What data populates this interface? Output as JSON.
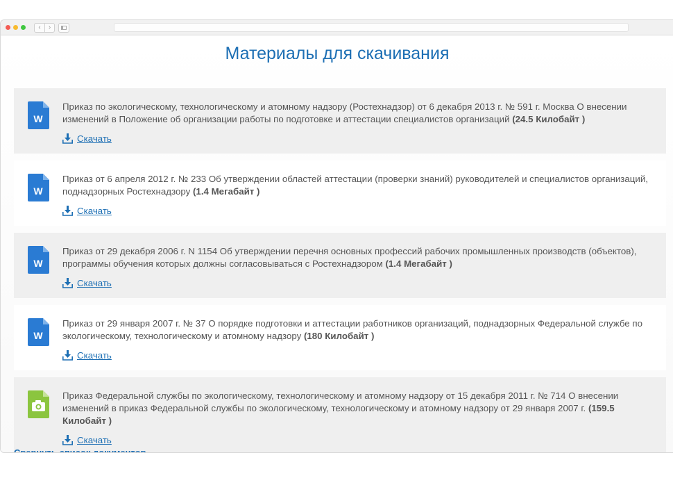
{
  "colors": {
    "accent": "#1d6fb4",
    "word_icon": "#2a7bd3",
    "image_icon": "#8bc53f",
    "card_bg": "#efefef",
    "text": "#555555"
  },
  "browser": {
    "traffic_lights": [
      "#f45c54",
      "#f8bb2f",
      "#3fc73f"
    ],
    "back_glyph": "‹",
    "forward_glyph": "›"
  },
  "page": {
    "title": "Материалы для скачивания"
  },
  "documents": [
    {
      "icon": "word-document-icon",
      "icon_letter": "W",
      "description": "Приказ по экологическому, технологическому и атомному надзору (Ростехнадзор) от 6 декабря 2013 г. № 591 г. Москва О внесении изменений в Положение об организации работы по подготовке и аттестации специалистов организаций",
      "size": "(24.5 Килобайт )",
      "download_label": "Скачать"
    },
    {
      "icon": "word-document-icon",
      "icon_letter": "W",
      "description": "Приказ от 6 апреля 2012 г. № 233 Об утверждении областей аттестации (проверки знаний) руководителей и специалистов организаций, поднадзорных Ростехнадзору",
      "size": "(1.4 Мегабайт )",
      "download_label": "Скачать"
    },
    {
      "icon": "word-document-icon",
      "icon_letter": "W",
      "description": "Приказ от 29 декабря 2006 г. N 1154 Об утверждении перечня основных профессий рабочих промышленных производств (объектов), программы обучения которых должны согласовываться с Ростехнадзором",
      "size": "(1.4 Мегабайт )",
      "download_label": "Скачать"
    },
    {
      "icon": "word-document-icon",
      "icon_letter": "W",
      "description": "Приказ от 29 января 2007 г. № 37 О порядке подготовки и аттестации работников организаций, поднадзорных Федеральной службе по экологическому, технологическому и атомному надзору",
      "size": "(180 Килобайт )",
      "download_label": "Скачать"
    },
    {
      "icon": "image-document-icon",
      "icon_letter": "",
      "description": "Приказ Федеральной службы по экологическому, технологическому и атомному надзору от 15 декабря 2011 г. № 714 О внесении изменений в приказ Федеральной службы по экологическому, технологическому и атомному надзору от 29 января 2007 г.",
      "size": "(159.5 Килобайт )",
      "download_label": "Скачать"
    }
  ],
  "collapse_label": "Свернуть список документов"
}
